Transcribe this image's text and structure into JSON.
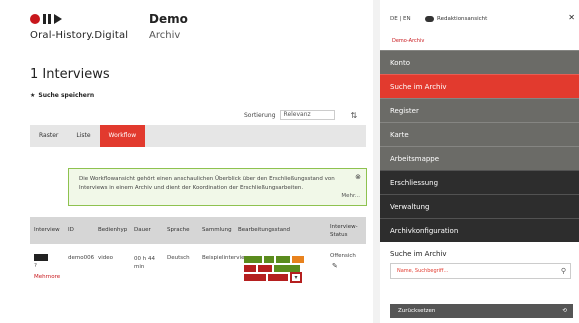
{
  "brand": {
    "name": "Oral-History.Digital"
  },
  "project": {
    "title": "Demo",
    "subtitle": "Archiv"
  },
  "main": {
    "count": "1 Interviews",
    "save_search": "Suche speichern",
    "sort_label": "Sortierung",
    "sort_value": "Relevanz",
    "view_tabs": [
      "Raster",
      "Liste",
      "Workflow"
    ],
    "info_text": "Die Workflowansicht gehört einen anschaulichen Überblick über den Erschließungsstand von Interviews in einem Archiv und dient der Koordination der Erschließungsarbeiten.",
    "info_more": "Mehr...",
    "table_headers": [
      "Interview",
      "ID",
      "Bedienhyp",
      "Dauer",
      "Sprache",
      "Sammlung",
      "Bearbeitungsstand",
      "Interview-Status"
    ],
    "row": {
      "id": "demo006",
      "type": "video",
      "duration": "00 h 44 min",
      "language": "Deutsch",
      "collection": "Beispielinterviews",
      "status": "Offensich",
      "link": "Mehrnore"
    },
    "status_colors": {
      "green": "#5b8c1e",
      "orange": "#e8821e",
      "red": "#b51f1f",
      "white": "#ffffff"
    }
  },
  "sidebar": {
    "lang": "DE | EN",
    "editorial_label": "Redaktionsansicht",
    "breadcrumb": "Demo-Archiv",
    "nav": [
      "Konto",
      "Suche im Archiv",
      "Register",
      "Karte",
      "Arbeitsmappe",
      "Erschliessung",
      "Verwaltung",
      "Archivkonfiguration"
    ],
    "panel_title": "Suche im Archiv",
    "search_placeholder": "Name, Suchbegriff...",
    "reset_label": "Zurücksetzen"
  }
}
